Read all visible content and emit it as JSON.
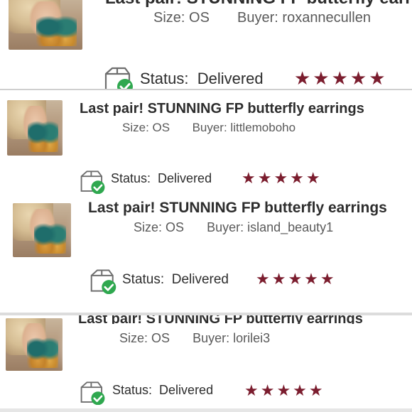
{
  "colors": {
    "star": "#7b1d2e",
    "check": "#2fa84f",
    "separator": "#cfcfcf"
  },
  "icons": {
    "box": "package-delivered-icon",
    "star": "star-icon"
  },
  "reviews": [
    {
      "title": "Last pair! STUNNING FP butterfly earrings",
      "size_label": "Size: OS",
      "buyer_label": "Buyer: roxannecullen",
      "status_label": "Status:",
      "status_value": "Delivered",
      "rating": 5,
      "stars": "★★★★★"
    },
    {
      "title": "Last pair! STUNNING FP butterfly earrings",
      "size_label": "Size: OS",
      "buyer_label": "Buyer: littlemoboho",
      "status_label": "Status:",
      "status_value": "Delivered",
      "rating": 5,
      "stars": "★★★★★"
    },
    {
      "title": "Last pair! STUNNING FP butterfly earrings",
      "size_label": "Size: OS",
      "buyer_label": "Buyer: island_beauty1",
      "status_label": "Status:",
      "status_value": "Delivered",
      "rating": 5,
      "stars": "★★★★★"
    },
    {
      "title": "Last pair! STUNNING FP butterfly earrings",
      "size_label": "Size: OS",
      "buyer_label": "Buyer: lorilei3",
      "status_label": "Status:",
      "status_value": "Delivered",
      "rating": 5,
      "stars": "★★★★★"
    }
  ]
}
